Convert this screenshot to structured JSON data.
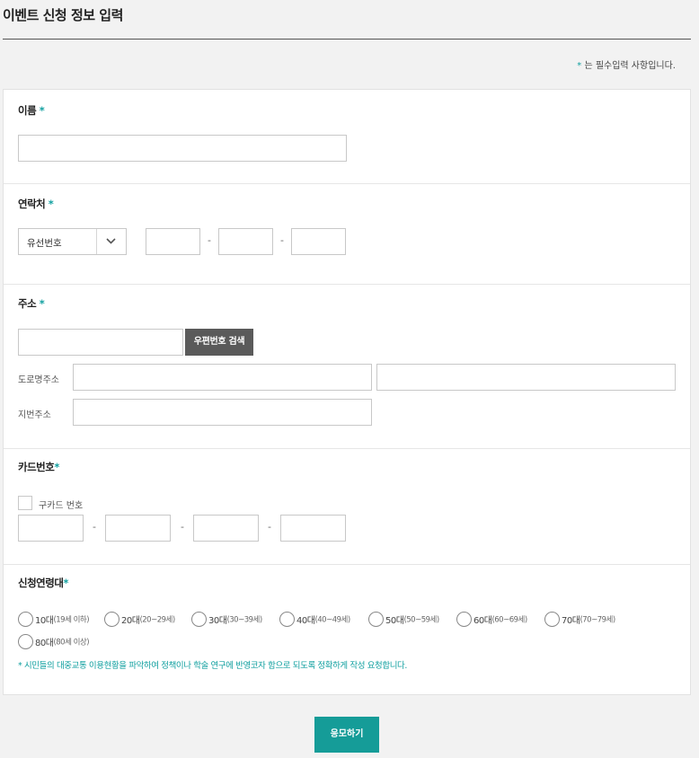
{
  "page": {
    "title": "이벤트 신청 정보 입력",
    "required_mark": "*",
    "required_note": "는 필수입력 사항입니다."
  },
  "name_section": {
    "label": "이름",
    "name_value": ""
  },
  "contact_section": {
    "label": "연락처",
    "phone_type_value": "유선번호",
    "dash": "-",
    "phone_part1": "",
    "phone_part2": "",
    "phone_part3": ""
  },
  "address_section": {
    "label": "주소",
    "postcode_value": "",
    "postcode_search_label": "우편번호 검색",
    "road_label": "도로명주소",
    "road_value": "",
    "road_detail_value": "",
    "jibun_label": "지번주소",
    "jibun_value": ""
  },
  "card_section": {
    "label": "카드번호",
    "old_card_label": "구카드 번호",
    "old_card_checked": false,
    "dash": "-",
    "card_part1": "",
    "card_part2": "",
    "card_part3": "",
    "card_part4": ""
  },
  "age_section": {
    "label": "신청연령대",
    "options": [
      {
        "label": "10대",
        "range": "(19세 이하)"
      },
      {
        "label": "20대",
        "range": "(20~29세)"
      },
      {
        "label": "30대",
        "range": "(30~39세)"
      },
      {
        "label": "40대",
        "range": "(40~49세)"
      },
      {
        "label": "50대",
        "range": "(50~59세)"
      },
      {
        "label": "60대",
        "range": "(60~69세)"
      },
      {
        "label": "70대",
        "range": "(70~79세)"
      },
      {
        "label": "80대",
        "range": "(80세 이상)"
      }
    ],
    "notice": "* 시민들의 대중교통 이용현황을 파악하여 정책이나 학술 연구에 반영코자 함으로 되도록 정확하게 작성 요청합니다."
  },
  "submit": {
    "label": "응모하기"
  },
  "colors": {
    "accent": "#12a0a0",
    "submit_bg": "#159c98",
    "search_button_bg": "#5a5a5a"
  },
  "icons": {
    "select_arrow": "chevron-down-icon"
  }
}
